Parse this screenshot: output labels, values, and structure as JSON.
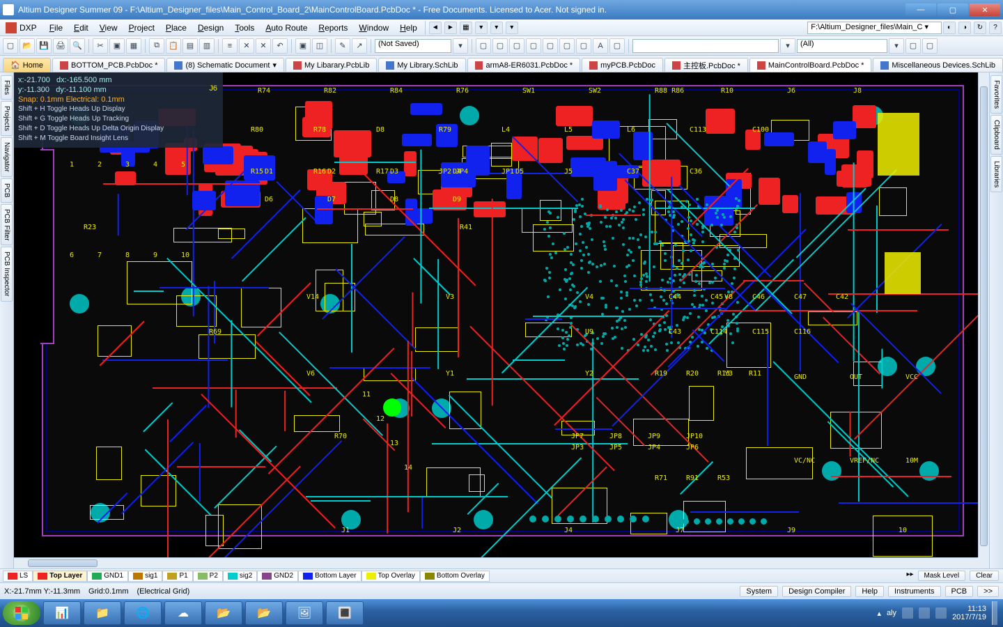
{
  "window": {
    "title": "Altium Designer Summer 09 - F:\\Altium_Designer_files\\Main_Control_Board_2\\MainControlBoard.PcbDoc * - Free Documents. Licensed to Acer. Not signed in."
  },
  "menu": {
    "dxp": "DXP",
    "items": [
      "File",
      "Edit",
      "View",
      "Project",
      "Place",
      "Design",
      "Tools",
      "Auto Route",
      "Reports",
      "Window",
      "Help"
    ],
    "file_combo": "F:\\Altium_Designer_files\\Main_C"
  },
  "toolbar1": {
    "notsaved": "(Not Saved)",
    "filter_all": "(All)",
    "filter_blank": ""
  },
  "doctabs": {
    "home": "Home",
    "tabs": [
      {
        "label": "BOTTOM_PCB.PcbDoc *",
        "icon": "red"
      },
      {
        "label": "(8) Schematic Document",
        "icon": "blue"
      },
      {
        "label": "My Libarary.PcbLib",
        "icon": "red"
      },
      {
        "label": "My Library.SchLib",
        "icon": "blue"
      },
      {
        "label": "armA8-ER6031.PcbDoc *",
        "icon": "red"
      },
      {
        "label": "myPCB.PcbDoc",
        "icon": "red"
      },
      {
        "label": "主控板.PcbDoc *",
        "icon": "red"
      },
      {
        "label": "MainControlBoard.PcbDoc *",
        "icon": "red",
        "active": true
      },
      {
        "label": "Miscellaneous Devices.SchLib",
        "icon": "blue"
      }
    ]
  },
  "siderail_left": [
    "Files",
    "Projects",
    "Navigator",
    "PCB",
    "PCB Filter",
    "PCB Inspector"
  ],
  "siderail_right": [
    "Favorites",
    "Clipboard",
    "Libraries"
  ],
  "hud": {
    "x": "x:-21.700",
    "dx": "dx:-165.500  mm",
    "y": "y:-11.300",
    "dy": "dy:-11.100   mm",
    "snap": "Snap: 0.1mm Electrical: 0.1mm",
    "j6": "J6",
    "h1": "Shift + H  Toggle Heads Up Display",
    "h2": "Shift + G  Toggle Heads Up Tracking",
    "h3": "Shift + D  Toggle Heads Up Delta Origin Display",
    "h4": "Shift + M Toggle Board Insight Lens"
  },
  "board_labels": {
    "top_row": [
      "R74",
      "R82",
      "R84",
      "R76",
      "SW1",
      "SW2",
      "R88 R86",
      "R10",
      "J6",
      "J8"
    ],
    "leds": [
      "D1",
      "D2",
      "D3",
      "D4",
      "D5",
      "D6",
      "D7",
      "D8",
      "D9"
    ],
    "mid": [
      "R80",
      "R78",
      "D8",
      "R79",
      "L4",
      "L5",
      "L6",
      "C113",
      "C100",
      "R15",
      "R16",
      "R17",
      "JP2 JP4",
      "JP1",
      "J5",
      "C37",
      "C36"
    ],
    "ic": [
      "V14",
      "V3",
      "V4",
      "V8",
      "V6",
      "Y1",
      "Y2",
      "Y3"
    ],
    "caps": [
      "C44",
      "C45",
      "C46",
      "C47",
      "C42",
      "C43",
      "C114",
      "C115",
      "C116"
    ],
    "jp": [
      "JP7",
      "JP8",
      "JP9",
      "JP10",
      "JP3",
      "JP5",
      "JP4",
      "JP6"
    ],
    "res": [
      "R19",
      "R20",
      "R13",
      "R11",
      "R71",
      "R91",
      "R53"
    ],
    "conn": [
      "J1",
      "J2",
      "J4",
      "J7",
      "J9",
      "10"
    ],
    "nets": [
      "GND",
      "OUT",
      "VCC",
      "VC/NC",
      "VREF/NC",
      "10M"
    ],
    "pins": [
      "1",
      "2",
      "3",
      "4",
      "5",
      "6",
      "7",
      "8",
      "9",
      "10",
      "11",
      "12",
      "13",
      "14"
    ],
    "misc": [
      "R23",
      "R69",
      "R70",
      "R41",
      "U9"
    ]
  },
  "layers": [
    {
      "name": "LS",
      "color": "#e22"
    },
    {
      "name": "Top Layer",
      "color": "#e22",
      "active": true
    },
    {
      "name": "GND1",
      "color": "#2a5"
    },
    {
      "name": "sig1",
      "color": "#b70"
    },
    {
      "name": "P1",
      "color": "#c0a020"
    },
    {
      "name": "P2",
      "color": "#8b6"
    },
    {
      "name": "sig2",
      "color": "#0cc"
    },
    {
      "name": "GND2",
      "color": "#848"
    },
    {
      "name": "Bottom Layer",
      "color": "#12e"
    },
    {
      "name": "Top Overlay",
      "color": "#ee0"
    },
    {
      "name": "Bottom Overlay",
      "color": "#880"
    }
  ],
  "layer_end": {
    "mask": "Mask Level",
    "clear": "Clear"
  },
  "status": {
    "coords": "X:-21.7mm Y:-11.3mm",
    "grid": "Grid:0.1mm",
    "egrid": "(Electrical Grid)",
    "right": [
      "System",
      "Design Compiler",
      "Help",
      "Instruments",
      "PCB",
      ">>"
    ]
  },
  "taskbar": {
    "apps": [
      "pptx-icon",
      "explorer-icon",
      "chrome-icon",
      "baidu-icon",
      "folder-icon",
      "folder2-icon",
      "preview-icon",
      "pcb-icon"
    ],
    "ime": "aly",
    "time": "11:13",
    "date": "2017/7/19"
  }
}
